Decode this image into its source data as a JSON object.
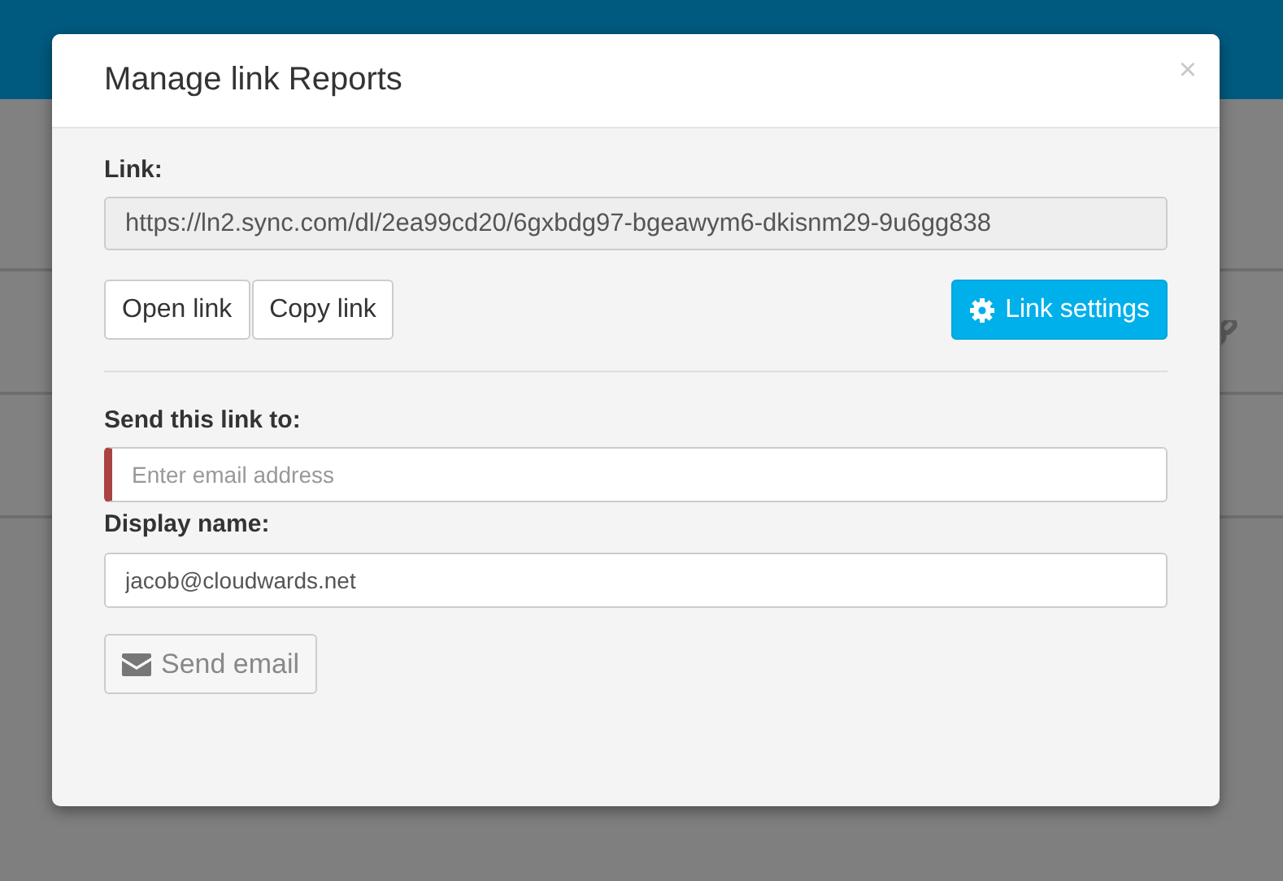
{
  "dialog": {
    "title": "Manage link Reports",
    "close": "×",
    "link_label": "Link:",
    "link_value": "https://ln2.sync.com/dl/2ea99cd20/6gxbdg97-bgeawym6-dkisnm29-9u6gg838",
    "buttons": [
      {
        "label": "Open link",
        "kind": "plain"
      },
      {
        "label": "Copy link",
        "kind": "plain"
      },
      {
        "label": "Link settings",
        "kind": "primary"
      }
    ],
    "send_label": "Send this link to:",
    "email_field": {
      "placeholder": "Enter email address",
      "invalid": true
    },
    "name_label": "Display name:",
    "name_field": {
      "value": "jacob@cloudwards.net"
    },
    "send_button": {
      "label": "Send email",
      "disabled": true
    }
  }
}
